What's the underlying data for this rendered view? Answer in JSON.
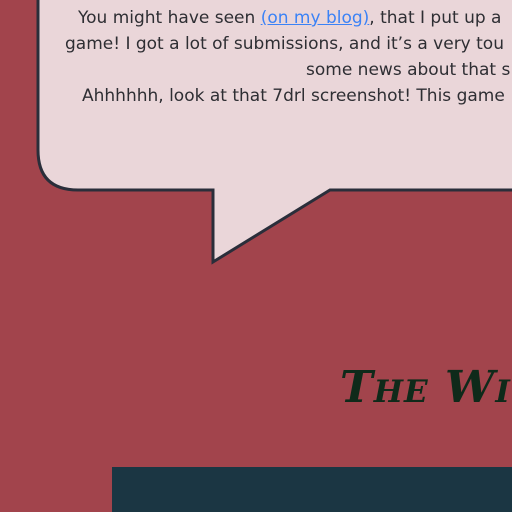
{
  "bubble": {
    "line1_pre": "You might have seen ",
    "line1_link": "(on my blog)",
    "line1_post": ", that I put up a",
    "line2": "game! I got a lot of submissions, and it’s a very tou",
    "line3": "some news about that s",
    "line4": "Ahhhhhh, look at that 7drl screenshot! This game"
  },
  "heading": "The Wit",
  "colors": {
    "background": "#a2444c",
    "bubble": "#ead6d9",
    "border": "#2a2e3a",
    "link": "#3b82f6",
    "heading": "#0f2a1a",
    "panel": "#1b3643"
  }
}
